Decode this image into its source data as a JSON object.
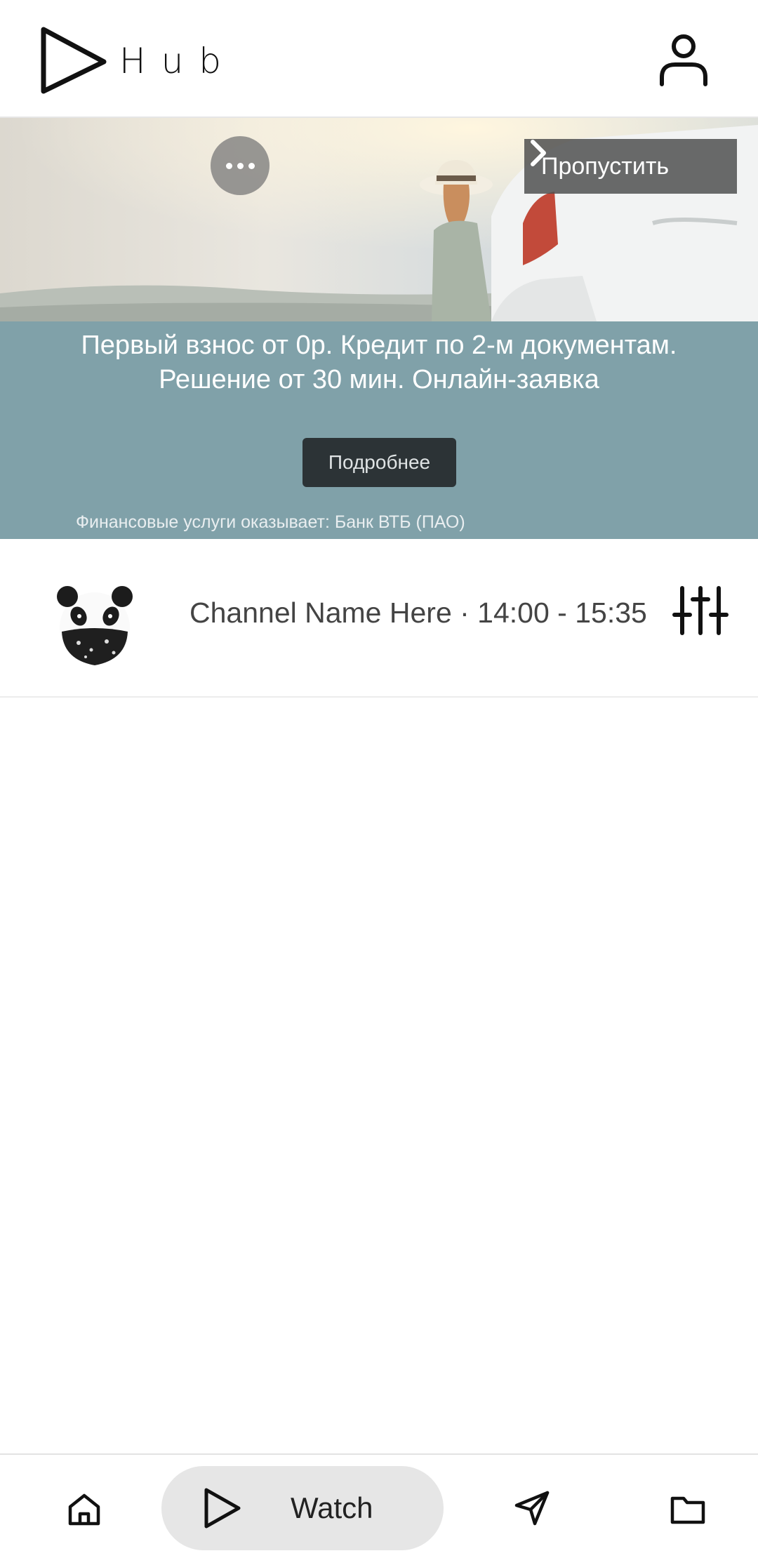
{
  "app": {
    "logo_text": "Hub"
  },
  "header": {
    "profile_icon": "user-icon"
  },
  "ad": {
    "more_icon": "more-horizontal-icon",
    "skip_label": "Пропустить",
    "headline": "Первый взнос от 0р. Кредит по 2-м документам. Решение от 30 мин. Онлайн-заявка",
    "cta_label": "Подробнее",
    "disclaimer": "Финансовые услуги оказывает: Банк ВТБ (ПАО)",
    "background_color": "#80a1a9"
  },
  "channel": {
    "info": "Channel Name Here · 14:00 - 15:35",
    "avatar_icon": "panda-avatar",
    "filter_icon": "sliders-icon"
  },
  "bottom_nav": {
    "home_icon": "home-icon",
    "watch_label": "Watch",
    "watch_icon": "play-icon",
    "send_icon": "send-icon",
    "folder_icon": "folder-icon",
    "active_tab": "Watch"
  }
}
